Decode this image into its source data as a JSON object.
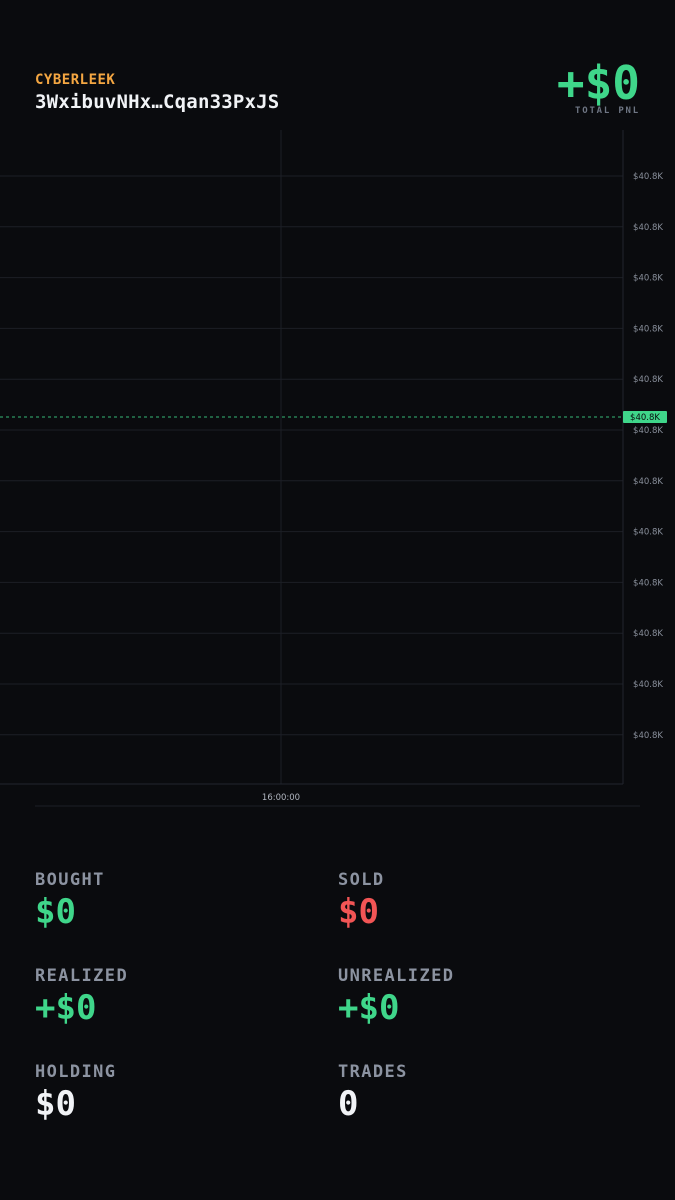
{
  "header": {
    "brand": "CYBERLEEK",
    "wallet": "3WxibuvNHx…Cqan33PxJS",
    "total_pnl_value": "+$0",
    "total_pnl_label": "TOTAL PNL"
  },
  "chart_data": {
    "type": "line",
    "y_tick_labels": [
      "$40.8K",
      "$40.8K",
      "$40.8K",
      "$40.8K",
      "$40.8K",
      "$40.8K",
      "$40.8K",
      "$40.8K",
      "$40.8K",
      "$40.8K",
      "$40.8K",
      "$40.8K"
    ],
    "x_tick_labels": [
      "16:00:00"
    ],
    "current_price_label": "$40.8K",
    "grid": true,
    "colors": {
      "price_line": "#3fd68a",
      "grid": "#1c1f26",
      "axis_text": "#8a909c"
    }
  },
  "stats": {
    "bought": {
      "label": "BOUGHT",
      "value": "$0"
    },
    "sold": {
      "label": "SOLD",
      "value": "$0"
    },
    "realized": {
      "label": "REALIZED",
      "value": "+$0"
    },
    "unrealized": {
      "label": "UNREALIZED",
      "value": "+$0"
    },
    "holding": {
      "label": "HOLDING",
      "value": "$0"
    },
    "trades": {
      "label": "TRADES",
      "value": "0"
    }
  },
  "colors": {
    "background": "#0a0b0e",
    "brand": "#f5a742",
    "positive": "#3fd68a",
    "negative": "#f25555"
  }
}
